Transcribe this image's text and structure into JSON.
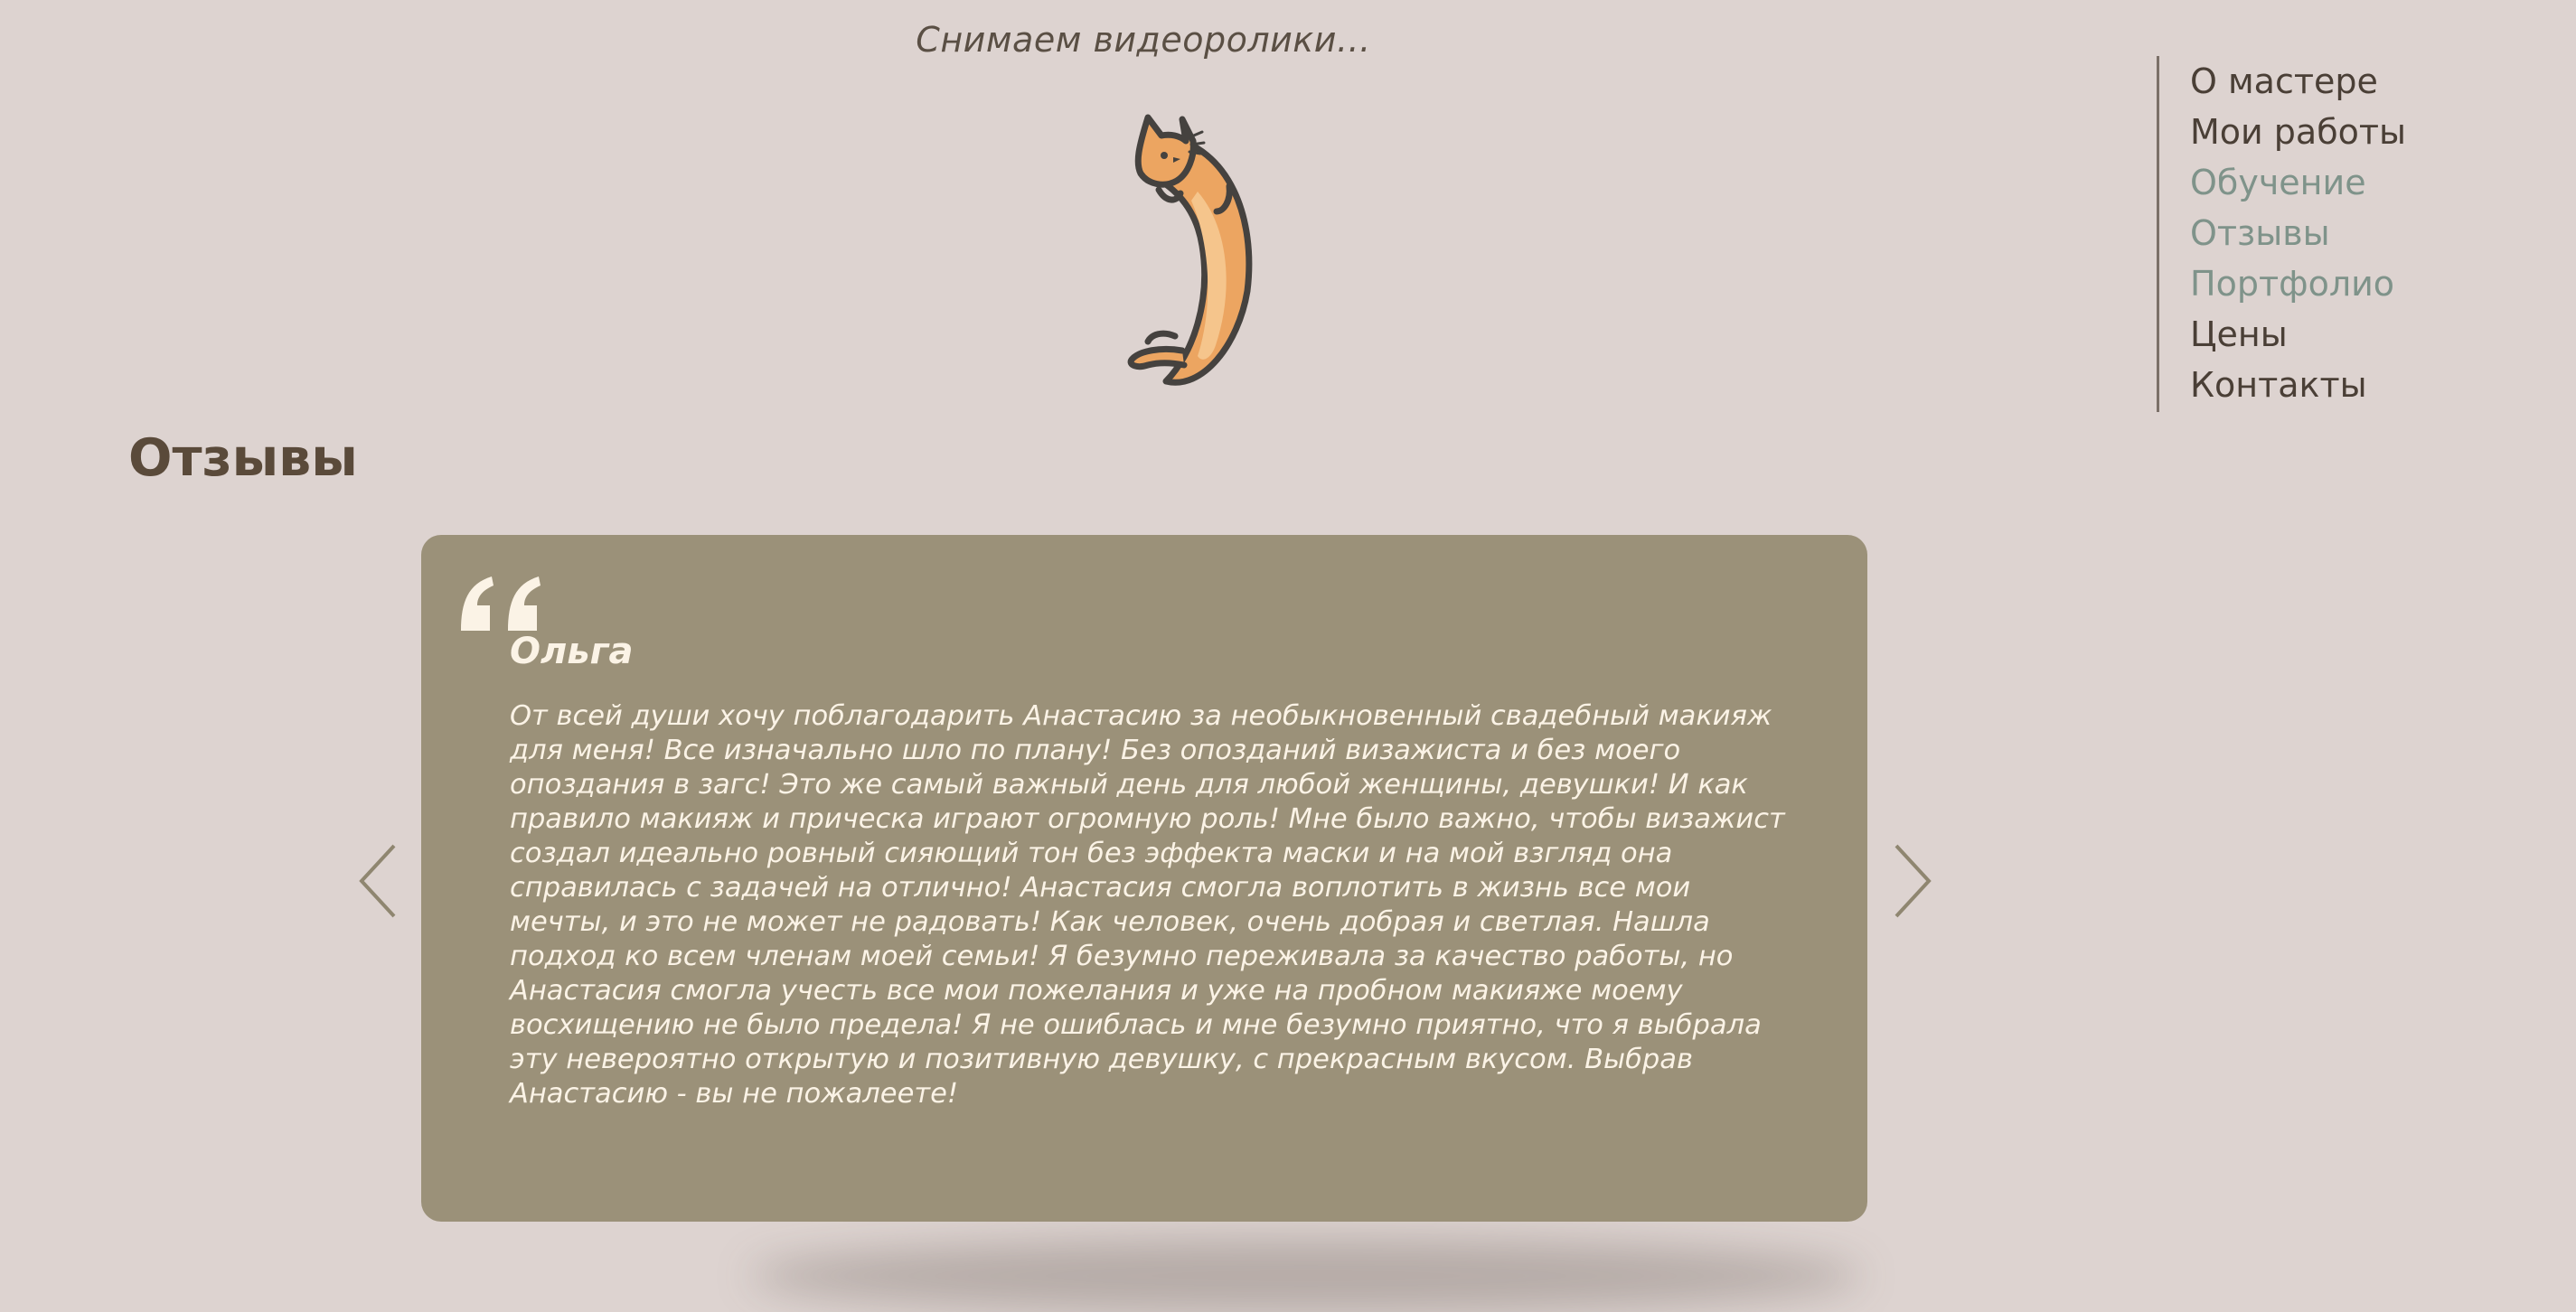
{
  "loading": {
    "caption": "Снимаем видеоролики..."
  },
  "nav": {
    "items": [
      {
        "label": "О мастере",
        "style": "dark"
      },
      {
        "label": "Мои работы",
        "style": "dark"
      },
      {
        "label": "Обучение",
        "style": "muted"
      },
      {
        "label": "Отзывы",
        "style": "muted"
      },
      {
        "label": "Портфолио",
        "style": "muted"
      },
      {
        "label": "Цены",
        "style": "dark"
      },
      {
        "label": "Контакты",
        "style": "dark"
      }
    ]
  },
  "section": {
    "title": "Отзывы"
  },
  "review": {
    "author": "Ольга",
    "text": "От всей души хочу поблагодарить Анастасию за необыкновенный свадебный макияж для меня! Все изначально шло по плану! Без опозданий визажиста и без моего опоздания в загс! Это же самый важный день для любой женщины, девушки! И как правило макияж и прическа играют огромную роль! Мне было важно, чтобы визажист создал идеально ровный сияющий тон без эффекта маски и на мой взгляд она справилась с задачей на отлично! Анастасия смогла воплотить в жизнь все мои мечты, и это не может не радовать! Как человек, очень добрая и светлая. Нашла подход ко всем членам моей семьи! Я безумно переживала за качество работы, но Анастасия смогла учесть все мои пожелания и уже на пробном макияже моему восхищению не было предела! Я не ошиблась и мне безумно приятно, что я выбрала эту невероятно открытую и позитивную девушку, с прекрасным вкусом. Выбрав Анастасию - вы не пожалеете!"
  },
  "icons": {
    "loader": "cat-spinner-icon",
    "quote": "quote-icon",
    "prev": "chevron-left-icon",
    "next": "chevron-right-icon"
  },
  "colors": {
    "background": "#ddd3d0",
    "card": "#9b9179",
    "card_text": "#fbf3e6",
    "nav_dark": "#4a3f36",
    "nav_muted": "#7f938a",
    "title": "#5a4a3a",
    "cat_fill": "#eca561",
    "cat_outline": "#45423f"
  }
}
